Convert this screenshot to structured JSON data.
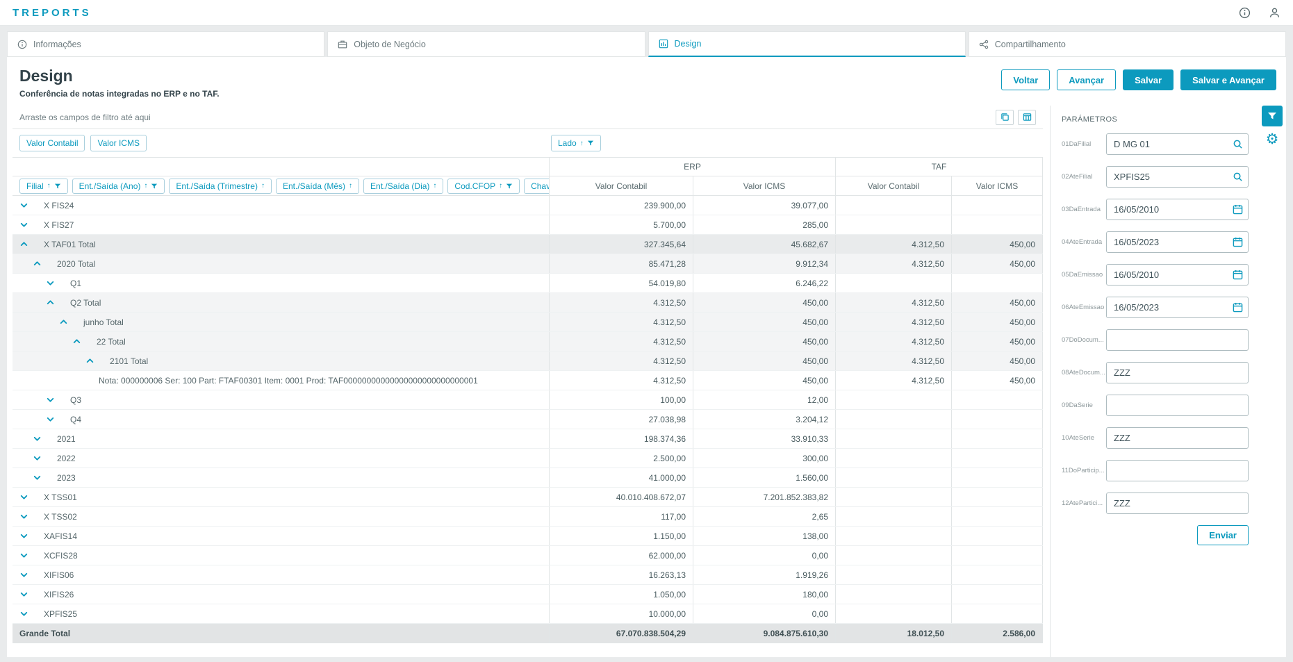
{
  "topbar": {
    "logo": "TREPORTS"
  },
  "tabs": [
    {
      "label": "Informações"
    },
    {
      "label": "Objeto de Negócio"
    },
    {
      "label": "Design"
    },
    {
      "label": "Compartilhamento"
    }
  ],
  "page": {
    "title": "Design",
    "subtitle": "Conferência de notas integradas no ERP e no TAF.",
    "actions": {
      "back": "Voltar",
      "forward": "Avançar",
      "save": "Salvar",
      "save_forward": "Salvar e Avançar"
    }
  },
  "pivot": {
    "filter_hint": "Arraste os campos de filtro até aqui",
    "measures": [
      {
        "label": "Valor Contabil"
      },
      {
        "label": "Valor ICMS"
      }
    ],
    "column_field": {
      "label": "Lado"
    },
    "row_fields": [
      {
        "label": "Filial",
        "filter": true
      },
      {
        "label": "Ent./Saída (Ano)",
        "filter": true
      },
      {
        "label": "Ent./Saída (Trimestre)",
        "filter": false
      },
      {
        "label": "Ent./Saída (Mês)",
        "filter": false
      },
      {
        "label": "Ent./Saída (Dia)",
        "filter": false
      },
      {
        "label": "Cod.CFOP",
        "filter": true
      },
      {
        "label": "Chave Nota",
        "filter": true
      }
    ],
    "column_groups": [
      {
        "label": "ERP"
      },
      {
        "label": "TAF"
      }
    ],
    "value_headers": [
      {
        "label": "Valor Contabil"
      },
      {
        "label": "Valor ICMS"
      },
      {
        "label": "Valor Contabil"
      },
      {
        "label": "Valor ICMS"
      }
    ],
    "rows": [
      {
        "label": "X FIS24",
        "level": 0,
        "chevron": "down",
        "kind": "leaf",
        "values": [
          "239.900,00",
          "39.077,00",
          "",
          ""
        ]
      },
      {
        "label": "X FIS27",
        "level": 0,
        "chevron": "down",
        "kind": "leaf",
        "values": [
          "5.700,00",
          "285,00",
          "",
          ""
        ]
      },
      {
        "label": "X TAF01 Total",
        "level": 0,
        "chevron": "up",
        "kind": "total",
        "highlight": true,
        "values": [
          "327.345,64",
          "45.682,67",
          "4.312,50",
          "450,00"
        ]
      },
      {
        "label": "2020 Total",
        "level": 1,
        "chevron": "up",
        "kind": "total",
        "values": [
          "85.471,28",
          "9.912,34",
          "4.312,50",
          "450,00"
        ]
      },
      {
        "label": "Q1",
        "level": 2,
        "chevron": "down",
        "kind": "leaf",
        "values": [
          "54.019,80",
          "6.246,22",
          "",
          ""
        ]
      },
      {
        "label": "Q2 Total",
        "level": 2,
        "chevron": "up",
        "kind": "total",
        "values": [
          "4.312,50",
          "450,00",
          "4.312,50",
          "450,00"
        ]
      },
      {
        "label": "junho Total",
        "level": 3,
        "chevron": "up",
        "kind": "total",
        "values": [
          "4.312,50",
          "450,00",
          "4.312,50",
          "450,00"
        ]
      },
      {
        "label": "22 Total",
        "level": 4,
        "chevron": "up",
        "kind": "total",
        "values": [
          "4.312,50",
          "450,00",
          "4.312,50",
          "450,00"
        ]
      },
      {
        "label": "2101 Total",
        "level": 5,
        "chevron": "up",
        "kind": "total",
        "values": [
          "4.312,50",
          "450,00",
          "4.312,50",
          "450,00"
        ]
      },
      {
        "label": "Nota: 000000006 Ser: 100 Part: FTAF00301 Item: 0001 Prod: TAF00000000000000000000000000001",
        "level": 6,
        "chevron": "none",
        "kind": "leaf",
        "values": [
          "4.312,50",
          "450,00",
          "4.312,50",
          "450,00"
        ]
      },
      {
        "label": "Q3",
        "level": 2,
        "chevron": "down",
        "kind": "leaf",
        "values": [
          "100,00",
          "12,00",
          "",
          ""
        ]
      },
      {
        "label": "Q4",
        "level": 2,
        "chevron": "down",
        "kind": "leaf",
        "values": [
          "27.038,98",
          "3.204,12",
          "",
          ""
        ]
      },
      {
        "label": "2021",
        "level": 1,
        "chevron": "down",
        "kind": "leaf",
        "values": [
          "198.374,36",
          "33.910,33",
          "",
          ""
        ]
      },
      {
        "label": "2022",
        "level": 1,
        "chevron": "down",
        "kind": "leaf",
        "values": [
          "2.500,00",
          "300,00",
          "",
          ""
        ]
      },
      {
        "label": "2023",
        "level": 1,
        "chevron": "down",
        "kind": "leaf",
        "values": [
          "41.000,00",
          "1.560,00",
          "",
          ""
        ]
      },
      {
        "label": "X TSS01",
        "level": 0,
        "chevron": "down",
        "kind": "leaf",
        "values": [
          "40.010.408.672,07",
          "7.201.852.383,82",
          "",
          ""
        ]
      },
      {
        "label": "X TSS02",
        "level": 0,
        "chevron": "down",
        "kind": "leaf",
        "values": [
          "117,00",
          "2,65",
          "",
          ""
        ]
      },
      {
        "label": "XAFIS14",
        "level": 0,
        "chevron": "down",
        "kind": "leaf",
        "values": [
          "1.150,00",
          "138,00",
          "",
          ""
        ]
      },
      {
        "label": "XCFIS28",
        "level": 0,
        "chevron": "down",
        "kind": "leaf",
        "values": [
          "62.000,00",
          "0,00",
          "",
          ""
        ]
      },
      {
        "label": "XIFIS06",
        "level": 0,
        "chevron": "down",
        "kind": "leaf",
        "values": [
          "16.263,13",
          "1.919,26",
          "",
          ""
        ]
      },
      {
        "label": "XIFIS26",
        "level": 0,
        "chevron": "down",
        "kind": "leaf",
        "values": [
          "1.050,00",
          "180,00",
          "",
          ""
        ]
      },
      {
        "label": "XPFIS25",
        "level": 0,
        "chevron": "down",
        "kind": "leaf",
        "values": [
          "10.000,00",
          "0,00",
          "",
          ""
        ]
      }
    ],
    "grand_total": {
      "label": "Grande Total",
      "values": [
        "67.070.838.504,29",
        "9.084.875.610,30",
        "18.012,50",
        "2.586,00"
      ]
    }
  },
  "params": {
    "title": "PARÁMETROS",
    "fields": [
      {
        "label": "01DaFilial",
        "value": "D MG 01",
        "icon": "search"
      },
      {
        "label": "02AteFilial",
        "value": "XPFIS25",
        "icon": "search"
      },
      {
        "label": "03DaEntrada",
        "value": "16/05/2010",
        "icon": "calendar"
      },
      {
        "label": "04AteEntrada",
        "value": "16/05/2023",
        "icon": "calendar"
      },
      {
        "label": "05DaEmissao",
        "value": "16/05/2010",
        "icon": "calendar"
      },
      {
        "label": "06AteEmissao",
        "value": "16/05/2023",
        "icon": "calendar"
      },
      {
        "label": "07DoDocum...",
        "value": "",
        "icon": "none"
      },
      {
        "label": "08AteDocum...",
        "value": "ZZZ",
        "icon": "none"
      },
      {
        "label": "09DaSerie",
        "value": "",
        "icon": "none"
      },
      {
        "label": "10AteSerie",
        "value": "ZZZ",
        "icon": "none"
      },
      {
        "label": "11DoParticip...",
        "value": "",
        "icon": "none"
      },
      {
        "label": "12AtePartici...",
        "value": "ZZZ",
        "icon": "none"
      }
    ],
    "submit": "Enviar"
  }
}
